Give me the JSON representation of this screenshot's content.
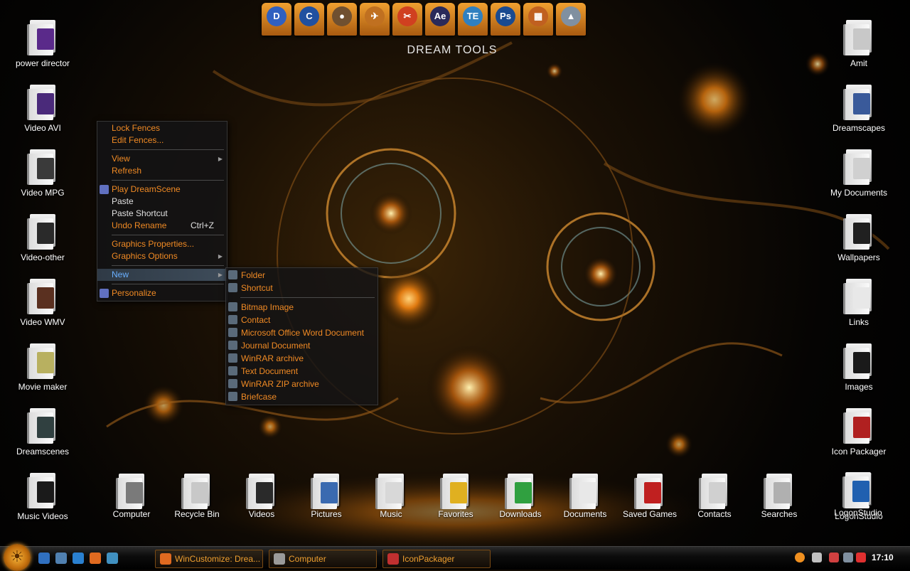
{
  "left_icons": [
    {
      "label": "power director",
      "icon": "folder-purple-icon",
      "thumb": "#5a2a8a"
    },
    {
      "label": "Video AVI",
      "icon": "folder-video-icon",
      "thumb": "#4a2a7a"
    },
    {
      "label": "Video MPG",
      "icon": "folder-video-icon",
      "thumb": "#3a3a3a"
    },
    {
      "label": "Video-other",
      "icon": "folder-video-icon",
      "thumb": "#2a2a2a"
    },
    {
      "label": "Video WMV",
      "icon": "folder-video-icon",
      "thumb": "#5a3020"
    },
    {
      "label": "Movie maker",
      "icon": "folder-movie-icon",
      "thumb": "#b8b060"
    },
    {
      "label": "Dreamscenes",
      "icon": "folder-dreamscene-icon",
      "thumb": "#304040"
    },
    {
      "label": "Music Videos",
      "icon": "folder-music-video-icon",
      "thumb": "#1a1a1a"
    }
  ],
  "right_icons": [
    {
      "label": "Amit",
      "icon": "folder-icon",
      "thumb": "#c8c8c8"
    },
    {
      "label": "Dreamscapes",
      "icon": "folder-images-icon",
      "thumb": "#3a5a9a"
    },
    {
      "label": "My Documents",
      "icon": "folder-documents-icon",
      "thumb": "#d0d0d0"
    },
    {
      "label": "Wallpapers",
      "icon": "folder-wallpapers-icon",
      "thumb": "#202020"
    },
    {
      "label": "Links",
      "icon": "folder-links-icon",
      "thumb": "#e8e8e8"
    },
    {
      "label": "Images",
      "icon": "folder-images-icon",
      "thumb": "#1a1a1a"
    },
    {
      "label": "Icon Packager",
      "icon": "folder-iconpackager-icon",
      "thumb": "#b02020"
    },
    {
      "label": "LogonStudio",
      "icon": "folder-logonstudio-icon",
      "thumb": "#2060b0"
    }
  ],
  "dream_tools": {
    "label": "DREAM TOOLS",
    "items": [
      {
        "name": "dreamscene-tool-1",
        "glyph": "D",
        "color": "#3060c0"
      },
      {
        "name": "dreamscene-tool-2",
        "glyph": "C",
        "color": "#2050a0"
      },
      {
        "name": "planet-tool",
        "glyph": "●",
        "color": "#705030"
      },
      {
        "name": "rocket-tool",
        "glyph": "✈",
        "color": "#c07020"
      },
      {
        "name": "clapper-tool",
        "glyph": "✂",
        "color": "#d04020"
      },
      {
        "name": "after-effects",
        "glyph": "Ae",
        "color": "#2a2a5a"
      },
      {
        "name": "video-editor",
        "glyph": "TE",
        "color": "#3080c0"
      },
      {
        "name": "photoshop",
        "glyph": "Ps",
        "color": "#1a4a90"
      },
      {
        "name": "film-tool",
        "glyph": "▦",
        "color": "#c06020"
      },
      {
        "name": "mountain-tool",
        "glyph": "▲",
        "color": "#8090a0"
      }
    ]
  },
  "context_menu": {
    "items": [
      {
        "label": "Lock Fences",
        "color": "orange"
      },
      {
        "label": "Edit Fences...",
        "color": "orange"
      },
      {
        "sep": true
      },
      {
        "label": "View",
        "color": "orange",
        "arrow": true
      },
      {
        "label": "Refresh",
        "color": "orange"
      },
      {
        "sep": true
      },
      {
        "label": "Play DreamScene",
        "color": "orange",
        "icon": "dreamscene-icon"
      },
      {
        "label": "Paste",
        "color": "white"
      },
      {
        "label": "Paste Shortcut",
        "color": "white"
      },
      {
        "label": "Undo Rename",
        "color": "orange",
        "shortcut": "Ctrl+Z"
      },
      {
        "sep": true
      },
      {
        "label": "Graphics Properties...",
        "color": "orange"
      },
      {
        "label": "Graphics Options",
        "color": "orange",
        "arrow": true
      },
      {
        "sep": true
      },
      {
        "label": "New",
        "color": "blue",
        "arrow": true,
        "selected": true
      },
      {
        "sep": true
      },
      {
        "label": "Personalize",
        "color": "orange",
        "icon": "personalize-icon"
      }
    ]
  },
  "new_submenu": {
    "items": [
      {
        "label": "Folder",
        "icon": "folder-icon"
      },
      {
        "label": "Shortcut",
        "icon": "shortcut-icon"
      },
      {
        "sep": true
      },
      {
        "label": "Bitmap Image",
        "icon": "bitmap-icon"
      },
      {
        "label": "Contact",
        "icon": "contact-icon"
      },
      {
        "label": "Microsoft Office Word Document",
        "icon": "word-icon"
      },
      {
        "label": "Journal Document",
        "icon": "journal-icon"
      },
      {
        "label": "WinRAR archive",
        "icon": "winrar-icon"
      },
      {
        "label": "Text Document",
        "icon": "text-icon"
      },
      {
        "label": "WinRAR ZIP archive",
        "icon": "winrar-zip-icon"
      },
      {
        "label": "Briefcase",
        "icon": "briefcase-icon"
      }
    ]
  },
  "bottom_icons": [
    {
      "label": "Computer",
      "icon": "computer-icon",
      "thumb": "#7a7a7a"
    },
    {
      "label": "Recycle Bin",
      "icon": "recycle-bin-icon",
      "thumb": "#c8c8c8"
    },
    {
      "label": "Videos",
      "icon": "videos-folder-icon",
      "thumb": "#2a2a2a"
    },
    {
      "label": "Pictures",
      "icon": "pictures-folder-icon",
      "thumb": "#3a6ab0"
    },
    {
      "label": "Music",
      "icon": "music-folder-icon",
      "thumb": "#d8d8d8"
    },
    {
      "label": "Favorites",
      "icon": "favorites-folder-icon",
      "thumb": "#e0b020"
    },
    {
      "label": "Downloads",
      "icon": "downloads-folder-icon",
      "thumb": "#30a040"
    },
    {
      "label": "Documents",
      "icon": "documents-folder-icon",
      "thumb": "#e8e8e8"
    },
    {
      "label": "Saved Games",
      "icon": "saved-games-folder-icon",
      "thumb": "#c02020"
    },
    {
      "label": "Contacts",
      "icon": "contacts-folder-icon",
      "thumb": "#d0d0d0"
    },
    {
      "label": "Searches",
      "icon": "searches-folder-icon",
      "thumb": "#b0b0b0"
    },
    {
      "label": "LogonStudio",
      "icon": "logonstudio-icon",
      "thumb": "#2060b0"
    }
  ],
  "taskbar": {
    "quick_launch": [
      {
        "name": "show-desktop-icon",
        "color": "#3070c0"
      },
      {
        "name": "switch-windows-icon",
        "color": "#5080b0"
      },
      {
        "name": "internet-explorer-icon",
        "color": "#2a80d0"
      },
      {
        "name": "firefox-icon",
        "color": "#e06a20"
      },
      {
        "name": "media-icon",
        "color": "#4090c0"
      }
    ],
    "tasks": [
      {
        "label": "WinCustomize: Drea...",
        "icon": "firefox-icon",
        "color": "#e06a20"
      },
      {
        "label": "Computer",
        "icon": "computer-icon",
        "color": "#9a9a9a"
      },
      {
        "label": "IconPackager",
        "icon": "iconpackager-icon",
        "color": "#c03030"
      }
    ],
    "tray": [
      {
        "name": "orange-orb-icon",
        "color": "#f09020"
      },
      {
        "name": "network-icon",
        "color": "#c0c0c0"
      },
      {
        "name": "usb-icon",
        "color": "#d04040"
      },
      {
        "name": "connection-icon",
        "color": "#8090a0"
      },
      {
        "name": "volume-muted-icon",
        "color": "#e03030"
      }
    ],
    "clock": "17:10"
  }
}
